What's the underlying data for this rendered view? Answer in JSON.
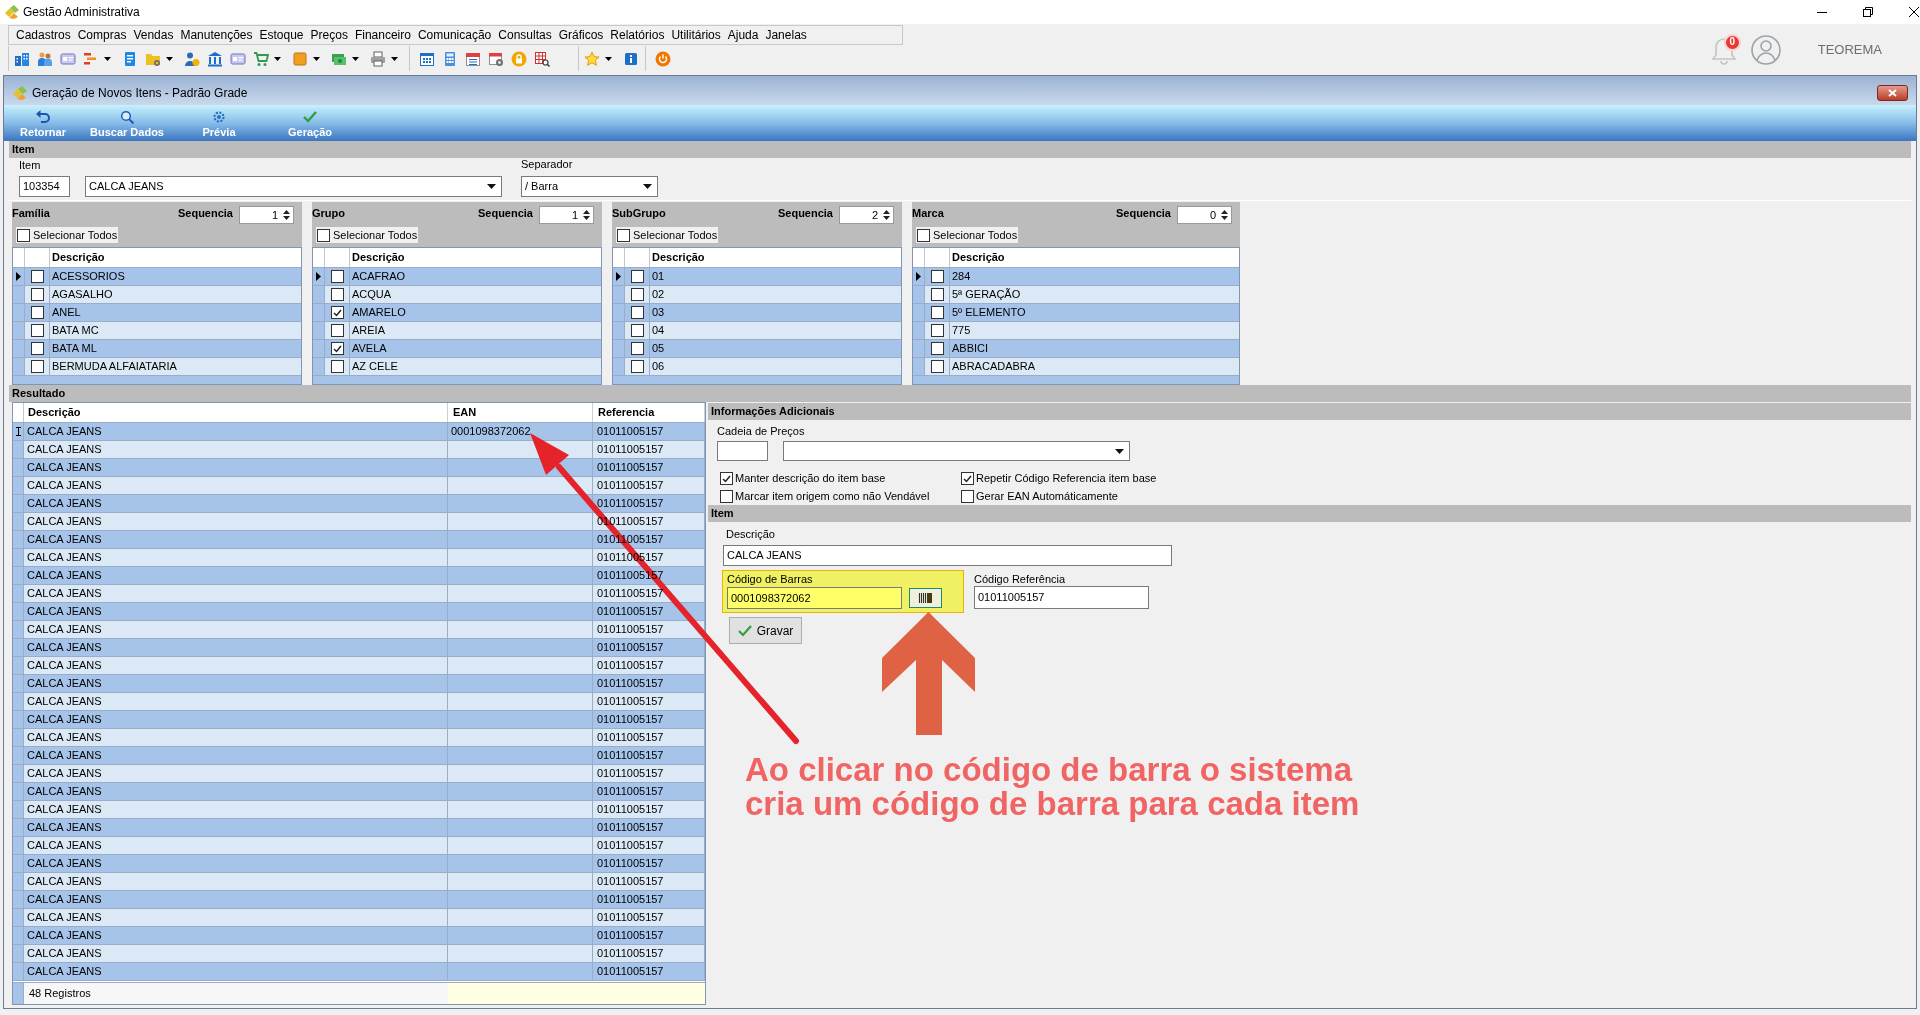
{
  "window": {
    "title": "Gestão Administrativa",
    "menu": [
      "Cadastros",
      "Compras",
      "Vendas",
      "Manutenções",
      "Estoque",
      "Preços",
      "Financeiro",
      "Comunicação",
      "Consultas",
      "Gráficos",
      "Relatórios",
      "Utilitários",
      "Ajuda",
      "Janelas"
    ],
    "toolbar": [
      [
        {
          "dropdown": false
        },
        {
          "dropdown": false
        },
        {
          "dropdown": false
        },
        {
          "dropdown": true
        },
        {
          "dropdown": false
        },
        {
          "dropdown": true
        },
        {
          "dropdown": false
        },
        {
          "dropdown": false
        },
        {
          "dropdown": false
        },
        {
          "dropdown": true
        },
        {
          "dropdown": true
        },
        {
          "dropdown": true
        },
        {
          "dropdown": true
        }
      ],
      [
        {
          "dropdown": false
        },
        {
          "dropdown": false
        },
        {
          "dropdown": false
        },
        {
          "dropdown": false
        },
        {
          "dropdown": false
        },
        {
          "dropdown": false
        }
      ],
      [
        {
          "dropdown": true
        },
        {
          "dropdown": false
        }
      ],
      [
        {
          "dropdown": false
        }
      ]
    ],
    "notifications": "0",
    "user": "TEOREMA"
  },
  "form": {
    "title": "Geração de Novos Itens - Padrão Grade",
    "actions": [
      "Retornar",
      "Buscar Dados",
      "Prévia",
      "Geração"
    ]
  },
  "item": {
    "header": "Item",
    "code_label": "Item",
    "code": "103354",
    "name": "CALCA JEANS",
    "separator_label": "Separador",
    "separator": "/ Barra"
  },
  "filters": [
    {
      "title": "Família",
      "sequence_label": "Sequencia",
      "sequence": "1",
      "select_all": {
        "label": "Selecionar Todos",
        "checked": false
      },
      "column": "Descrição",
      "rows": [
        {
          "label": "ACESSORIOS",
          "checked": false,
          "selected": true
        },
        {
          "label": "AGASALHO",
          "checked": false,
          "selected": false
        },
        {
          "label": "ANEL",
          "checked": false,
          "selected": false
        },
        {
          "label": "BATA MC",
          "checked": false,
          "selected": false
        },
        {
          "label": "BATA ML",
          "checked": false,
          "selected": false
        },
        {
          "label": "BERMUDA ALFAIATARIA",
          "checked": false,
          "selected": false
        }
      ]
    },
    {
      "title": "Grupo",
      "sequence_label": "Sequencia",
      "sequence": "1",
      "select_all": {
        "label": "Selecionar Todos",
        "checked": false
      },
      "column": "Descrição",
      "rows": [
        {
          "label": "ACAFRAO",
          "checked": false,
          "selected": true
        },
        {
          "label": "ACQUA",
          "checked": false,
          "selected": false
        },
        {
          "label": "AMARELO",
          "checked": true,
          "selected": false
        },
        {
          "label": "AREIA",
          "checked": false,
          "selected": false
        },
        {
          "label": "AVELA",
          "checked": true,
          "selected": false
        },
        {
          "label": "AZ CELE",
          "checked": false,
          "selected": false
        }
      ]
    },
    {
      "title": "SubGrupo",
      "sequence_label": "Sequencia",
      "sequence": "2",
      "select_all": {
        "label": "Selecionar Todos",
        "checked": false
      },
      "column": "Descrição",
      "rows": [
        {
          "label": "01",
          "checked": false,
          "selected": true
        },
        {
          "label": "02",
          "checked": false,
          "selected": false
        },
        {
          "label": "03",
          "checked": false,
          "selected": false
        },
        {
          "label": "04",
          "checked": false,
          "selected": false
        },
        {
          "label": "05",
          "checked": false,
          "selected": false
        },
        {
          "label": "06",
          "checked": false,
          "selected": false
        }
      ]
    },
    {
      "title": "Marca",
      "sequence_label": "Sequencia",
      "sequence": "0",
      "select_all": {
        "label": "Selecionar Todos",
        "checked": false
      },
      "column": "Descrição",
      "rows": [
        {
          "label": "284",
          "checked": false,
          "selected": true
        },
        {
          "label": "5ª GERAÇÃO",
          "checked": false,
          "selected": false
        },
        {
          "label": "5º ELEMENTO",
          "checked": false,
          "selected": false
        },
        {
          "label": "775",
          "checked": false,
          "selected": false
        },
        {
          "label": "ABBICI",
          "checked": false,
          "selected": false
        },
        {
          "label": "ABRACADABRA",
          "checked": false,
          "selected": false
        }
      ]
    }
  ],
  "result": {
    "header": "Resultado",
    "columns": [
      "Descrição",
      "EAN",
      "Referencia"
    ],
    "rows": [
      {
        "description": "CALCA JEANS",
        "ean": "0001098372062",
        "reference": "01011005157",
        "selected": true
      },
      {
        "description": "CALCA JEANS",
        "reference": "01011005157",
        "selected": false
      },
      {
        "description": "CALCA JEANS",
        "reference": "01011005157",
        "selected": false
      },
      {
        "description": "CALCA JEANS",
        "reference": "01011005157",
        "selected": false
      },
      {
        "description": "CALCA JEANS",
        "reference": "01011005157",
        "selected": false
      },
      {
        "description": "CALCA JEANS",
        "reference": "01011005157",
        "selected": false
      },
      {
        "description": "CALCA JEANS",
        "reference": "01011005157",
        "selected": false
      },
      {
        "description": "CALCA JEANS",
        "reference": "01011005157",
        "selected": false
      },
      {
        "description": "CALCA JEANS",
        "reference": "01011005157",
        "selected": false
      },
      {
        "description": "CALCA JEANS",
        "reference": "01011005157",
        "selected": false
      },
      {
        "description": "CALCA JEANS",
        "reference": "01011005157",
        "selected": false
      },
      {
        "description": "CALCA JEANS",
        "reference": "01011005157",
        "selected": false
      },
      {
        "description": "CALCA JEANS",
        "reference": "01011005157",
        "selected": false
      },
      {
        "description": "CALCA JEANS",
        "reference": "01011005157",
        "selected": false
      },
      {
        "description": "CALCA JEANS",
        "reference": "01011005157",
        "selected": false
      },
      {
        "description": "CALCA JEANS",
        "reference": "01011005157",
        "selected": false
      },
      {
        "description": "CALCA JEANS",
        "reference": "01011005157",
        "selected": false
      },
      {
        "description": "CALCA JEANS",
        "reference": "01011005157",
        "selected": false
      },
      {
        "description": "CALCA JEANS",
        "reference": "01011005157",
        "selected": false
      },
      {
        "description": "CALCA JEANS",
        "reference": "01011005157",
        "selected": false
      },
      {
        "description": "CALCA JEANS",
        "reference": "01011005157",
        "selected": false
      },
      {
        "description": "CALCA JEANS",
        "reference": "01011005157",
        "selected": false
      },
      {
        "description": "CALCA JEANS",
        "reference": "01011005157",
        "selected": false
      },
      {
        "description": "CALCA JEANS",
        "reference": "01011005157",
        "selected": false
      },
      {
        "description": "CALCA JEANS",
        "reference": "01011005157",
        "selected": false
      },
      {
        "description": "CALCA JEANS",
        "reference": "01011005157",
        "selected": false
      },
      {
        "description": "CALCA JEANS",
        "reference": "01011005157",
        "selected": false
      },
      {
        "description": "CALCA JEANS",
        "reference": "01011005157",
        "selected": false
      },
      {
        "description": "CALCA JEANS",
        "reference": "01011005157",
        "selected": false
      },
      {
        "description": "CALCA JEANS",
        "reference": "01011005157",
        "selected": false
      },
      {
        "description": "CALCA JEANS",
        "reference": "01011005157",
        "selected": false
      }
    ],
    "footer": "48 Registros"
  },
  "additional": {
    "header": "Informações Adicionais",
    "price_chain_label": "Cadeia de Preços",
    "options": [
      {
        "label": "Manter descrição do item base",
        "checked": true
      },
      {
        "label": "Repetir Código Referencia item base",
        "checked": true
      },
      {
        "label": "Marcar item origem como não Vendável",
        "checked": false
      },
      {
        "label": "Gerar EAN Automáticamente",
        "checked": false
      }
    ]
  },
  "item_detail": {
    "header": "Item",
    "description_label": "Descrição",
    "description": "CALCA JEANS",
    "barcode": {
      "label": "Código de Barras",
      "value": "0001098372062",
      "highlighted": true
    },
    "reference_label": "Código Referência",
    "reference": "01011005157",
    "save": "Gravar"
  },
  "annotation": {
    "lines": [
      "Ao clicar no código de barra o sistema",
      "cria um código de barra para cada item"
    ]
  }
}
